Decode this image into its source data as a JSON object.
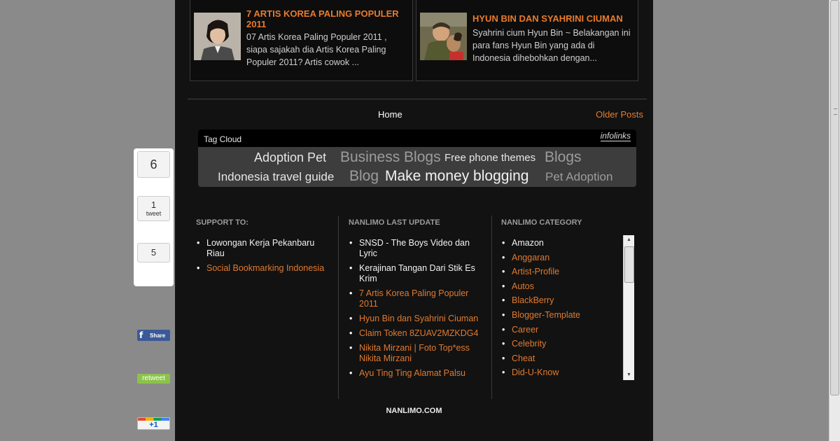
{
  "posts": [
    {
      "title": "7 ARTIS KOREA PALING POPULER 2011",
      "snippet": "07 Artis Korea Paling Populer 2011 , siapa sajakah dia Artis Korea Paling Populer 2011? Artis cowok ..."
    },
    {
      "title": "HYUN BIN DAN SYAHRINI CIUMAN",
      "snippet": "Syahrini cium Hyun Bin ~ Belakangan ini para fans Hyun Bin yang ada di Indonesia dihebohkan dengan..."
    }
  ],
  "pager": {
    "home": "Home",
    "older": "Older Posts"
  },
  "tag_cloud": {
    "title": "Tag Cloud",
    "brand": "infolinks",
    "tags": [
      "Adoption Pet",
      "Business Blogs",
      "Free phone themes",
      "Blogs",
      "Indonesia travel guide",
      "Blog",
      "Make money blogging",
      "Pet Adoption"
    ]
  },
  "support": {
    "heading": "SUPPORT TO:",
    "items": [
      "Lowongan Kerja Pekanbaru Riau",
      "Social Bookmarking Indonesia"
    ]
  },
  "last_update": {
    "heading": "NANLIMO LAST UPDATE",
    "items": [
      "SNSD - The Boys Video dan Lyric",
      "Kerajinan Tangan Dari Stik Es Krim",
      "7 Artis Korea Paling Populer 2011",
      "Hyun Bin dan Syahrini Ciuman",
      "Claim Token 8ZUAV2MZKDG4",
      "Nikita Mirzani | Foto Top*ess Nikita Mirzani",
      "Ayu Ting Ting Alamat Palsu"
    ]
  },
  "category": {
    "heading": "NANLIMO CATEGORY",
    "items": [
      "Amazon",
      "Anggaran",
      "Artist-Profile",
      "Autos",
      "BlackBerry",
      "Blogger-Template",
      "Career",
      "Celebrity",
      "Cheat",
      "Did-U-Know"
    ]
  },
  "footer": "NANLIMO.COM",
  "share_bar": {
    "fb_count": "6",
    "fb_label": "Share",
    "tweet_count": "1",
    "tweet_word": "tweet",
    "retweet_label": "retweet",
    "gplus_count": "5",
    "gplus_label": "+1"
  },
  "colors": {
    "page_bg": "#121212",
    "accent_orange": "#e87b2c",
    "facebook_blue": "#3b5998",
    "retweet_green": "#8bc34a"
  }
}
